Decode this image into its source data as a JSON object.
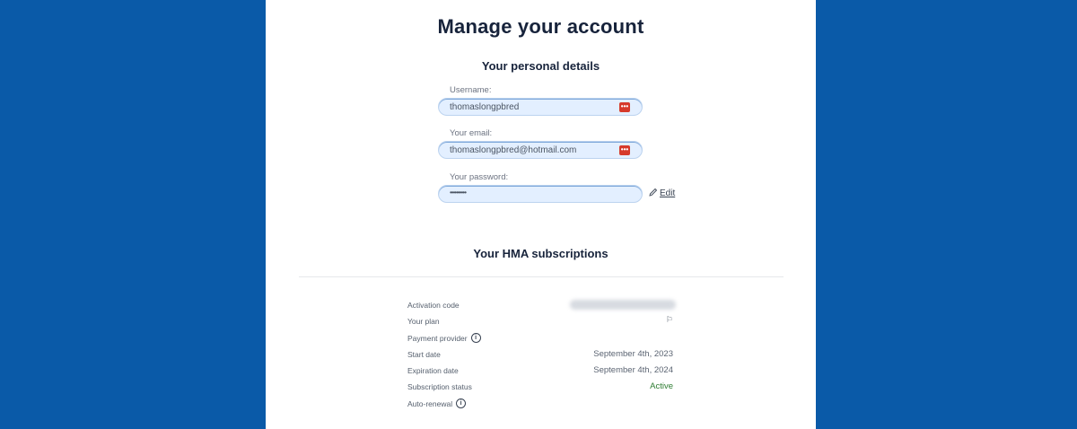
{
  "page": {
    "title": "Manage your account"
  },
  "personal": {
    "section_title": "Your personal details",
    "username": {
      "label": "Username:",
      "value": "thomaslongpbred",
      "icon": "password-manager-icon"
    },
    "email": {
      "label": "Your email:",
      "value": "thomaslongpbred@hotmail.com",
      "icon": "password-manager-icon"
    },
    "password": {
      "label": "Your password:",
      "value": "••••••••••"
    },
    "edit_label": "Edit"
  },
  "subscriptions": {
    "section_title": "Your HMA subscriptions",
    "activation_code_label": "Activation code",
    "plan_label": "Your plan",
    "plan_value": "⚐",
    "payment_provider_label": "Payment provider",
    "start_date_label": "Start date",
    "start_date_value": "September 4th, 2023",
    "expiration_date_label": "Expiration date",
    "expiration_date_value": "September 4th, 2024",
    "status_label": "Subscription status",
    "status_value": "Active",
    "auto_renewal_label": "Auto-renewal",
    "info_icon": "i"
  },
  "colors": {
    "background": "#0a5aa8",
    "panel": "#ffffff",
    "field_bg": "#e3efff",
    "status_active": "#2e7d32",
    "manager_icon": "#d63a2b"
  }
}
